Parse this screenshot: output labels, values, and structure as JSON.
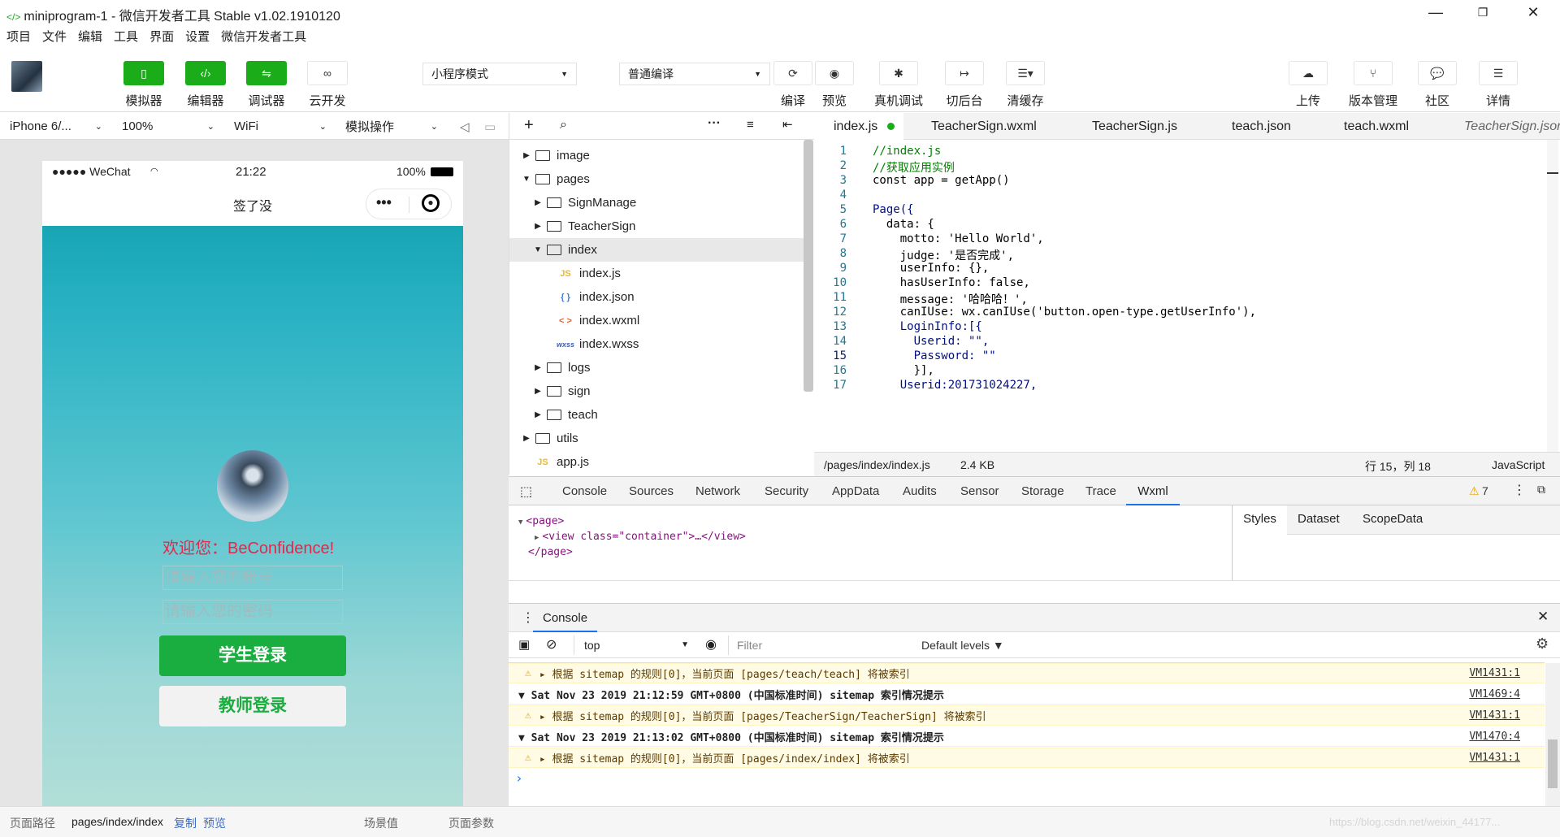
{
  "window": {
    "title": "miniprogram-1 - 微信开发者工具 Stable v1.02.1910120"
  },
  "menu": [
    "项目",
    "文件",
    "编辑",
    "工具",
    "界面",
    "设置",
    "微信开发者工具"
  ],
  "toolbar": {
    "simulator": "模拟器",
    "editor": "编辑器",
    "debugger": "调试器",
    "cloud": "云开发",
    "mode": "小程序模式",
    "compile_mode": "普通编译",
    "compile": "编译",
    "preview": "预览",
    "remote_debug": "真机调试",
    "background": "切后台",
    "clear_cache": "清缓存",
    "upload": "上传",
    "version": "版本管理",
    "community": "社区",
    "details": "详情"
  },
  "sim": {
    "device": "iPhone 6/...",
    "zoom": "100%",
    "network": "WiFi",
    "ops": "模拟操作",
    "status_carrier": "●●●●● WeChat",
    "status_time": "21:22",
    "status_battery": "100%",
    "nav_title": "签了没",
    "welcome": "欢迎您：BeConfidence!",
    "account_placeholder": "请输入您的账号",
    "password_placeholder": "请输入您的密码",
    "student_login": "学生登录",
    "teacher_login": "教师登录",
    "footer_path_label": "页面路径",
    "footer_path": "pages/index/index",
    "footer_copy": "复制",
    "footer_preview": "预览",
    "footer_scene": "场景值",
    "footer_params": "页面参数"
  },
  "tree": [
    {
      "name": "image",
      "type": "folder",
      "indent": 0,
      "state": "closed"
    },
    {
      "name": "pages",
      "type": "folder",
      "indent": 0,
      "state": "open"
    },
    {
      "name": "SignManage",
      "type": "folder",
      "indent": 1,
      "state": "closed"
    },
    {
      "name": "TeacherSign",
      "type": "folder",
      "indent": 1,
      "state": "closed"
    },
    {
      "name": "index",
      "type": "folder",
      "indent": 1,
      "state": "open"
    },
    {
      "name": "index.js",
      "type": "js",
      "indent": 2,
      "badge": "JS"
    },
    {
      "name": "index.json",
      "type": "json",
      "indent": 2,
      "badge": "{ }"
    },
    {
      "name": "index.wxml",
      "type": "wxml",
      "indent": 2,
      "badge": "< >"
    },
    {
      "name": "index.wxss",
      "type": "wxss",
      "indent": 2,
      "badge": "wxss"
    },
    {
      "name": "logs",
      "type": "folder",
      "indent": 1,
      "state": "closed"
    },
    {
      "name": "sign",
      "type": "folder",
      "indent": 1,
      "state": "closed"
    },
    {
      "name": "teach",
      "type": "folder",
      "indent": 1,
      "state": "closed"
    },
    {
      "name": "utils",
      "type": "folder",
      "indent": 0,
      "state": "closed"
    },
    {
      "name": "app.js",
      "type": "js",
      "indent": 0,
      "badge": "JS"
    }
  ],
  "tabs": [
    "index.js",
    "TeacherSign.wxml",
    "TeacherSign.js",
    "teach.json",
    "teach.wxml",
    "TeacherSign.json"
  ],
  "code": [
    {
      "n": "1",
      "t": "//index.js",
      "c": "cm"
    },
    {
      "n": "2",
      "t": "//获取应用实例",
      "c": "cm"
    },
    {
      "n": "3",
      "t": "const app = getApp()",
      "c": ""
    },
    {
      "n": "4",
      "t": "",
      "c": ""
    },
    {
      "n": "5",
      "t": "Page({",
      "c": ""
    },
    {
      "n": "6",
      "t": "  data: {",
      "c": ""
    },
    {
      "n": "7",
      "t": "    motto: 'Hello World',",
      "c": ""
    },
    {
      "n": "8",
      "t": "    judge: '是否完成',",
      "c": ""
    },
    {
      "n": "9",
      "t": "    userInfo: {},",
      "c": ""
    },
    {
      "n": "10",
      "t": "    hasUserInfo: false,",
      "c": ""
    },
    {
      "n": "11",
      "t": "    message: '哈哈哈！',",
      "c": ""
    },
    {
      "n": "12",
      "t": "    canIUse: wx.canIUse('button.open-type.getUserInfo'),",
      "c": ""
    },
    {
      "n": "13",
      "t": "    LoginInfo:[{",
      "c": ""
    },
    {
      "n": "14",
      "t": "      Userid: \"\",",
      "c": ""
    },
    {
      "n": "15",
      "t": "      Password: \"\"",
      "c": ""
    },
    {
      "n": "16",
      "t": "      }],",
      "c": ""
    },
    {
      "n": "17",
      "t": "    Userid:201731024227,",
      "c": ""
    }
  ],
  "editor_status": {
    "path": "/pages/index/index.js",
    "size": "2.4 KB",
    "cursor": "行 15，列 18",
    "lang": "JavaScript"
  },
  "devtools_tabs": [
    "Console",
    "Sources",
    "Network",
    "Security",
    "AppData",
    "Audits",
    "Sensor",
    "Storage",
    "Trace",
    "Wxml"
  ],
  "warn_count": "7",
  "wxml": {
    "line1": "<page>",
    "line2": "<view class=\"container\">…</view>",
    "line3": "</page>"
  },
  "style_tabs": [
    "Styles",
    "Dataset",
    "ScopeData"
  ],
  "console": {
    "title": "Console",
    "context": "top",
    "filter_placeholder": "Filter",
    "levels": "Default levels ▼",
    "rows": [
      {
        "kind": "warn",
        "text": "▸ 根据 sitemap 的规则[0]，当前页面 [pages/teach/teach] 将被索引",
        "src": "VM1431:1"
      },
      {
        "kind": "group",
        "text": "▼ Sat Nov 23 2019 21:12:59 GMT+0800 (中国标准时间) sitemap 索引情况提示",
        "src": "VM1469:4"
      },
      {
        "kind": "warn",
        "text": "▸ 根据 sitemap 的规则[0]，当前页面 [pages/TeacherSign/TeacherSign] 将被索引",
        "src": "VM1431:1"
      },
      {
        "kind": "group",
        "text": "▼ Sat Nov 23 2019 21:13:02 GMT+0800 (中国标准时间) sitemap 索引情况提示",
        "src": "VM1470:4"
      },
      {
        "kind": "warn",
        "text": "▸ 根据 sitemap 的规则[0]，当前页面 [pages/index/index] 将被索引",
        "src": "VM1431:1"
      }
    ],
    "prompt": "›"
  },
  "watermark": "https://blog.csdn.net/weixin_44177..."
}
